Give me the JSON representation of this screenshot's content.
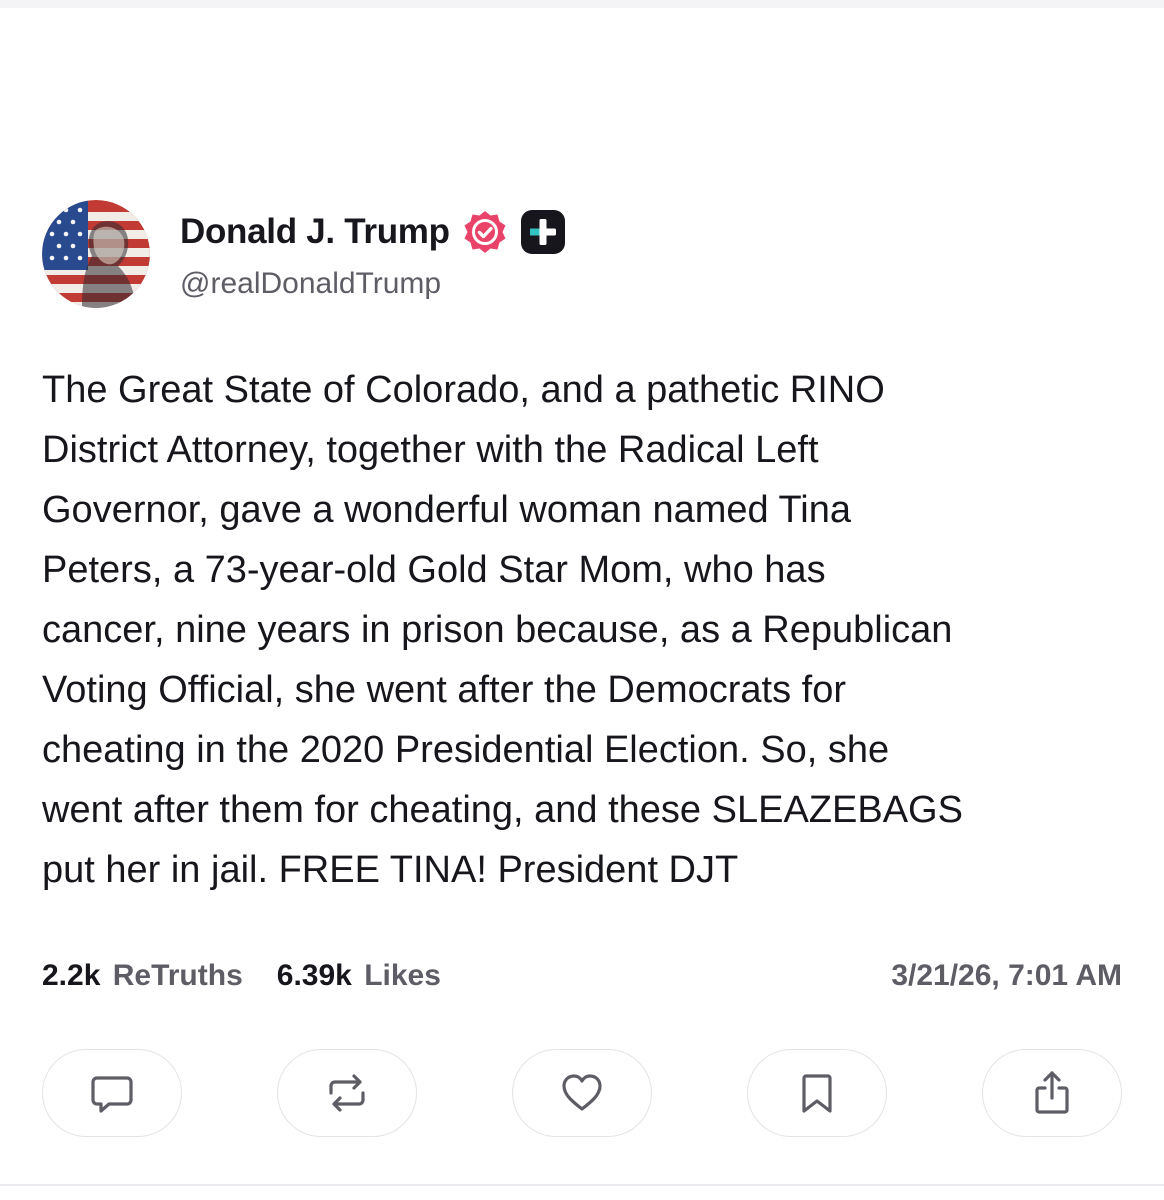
{
  "author": {
    "display_name": "Donald J. Trump",
    "handle": "@realDonaldTrump",
    "verified": true,
    "avatar_icon": "avatar-flag-portrait"
  },
  "post": {
    "text": "The Great State of Colorado, and a pathetic RINO\nDistrict Attorney, together with the Radical Left\nGovernor, gave a wonderful woman named Tina\nPeters, a 73-year-old Gold Star Mom, who has\ncancer, nine years in prison because, as a Republican\nVoting Official, she went after the Democrats for\ncheating in the 2020 Presidential Election. So, she\nwent after them for cheating, and these SLEAZEBAGS\nput her in jail. FREE TINA! President DJT"
  },
  "stats": {
    "retruths_count": "2.2k",
    "retruths_label": "ReTruths",
    "likes_count": "6.39k",
    "likes_label": "Likes",
    "timestamp": "3/21/26, 7:01 AM"
  },
  "actions": [
    {
      "name": "reply",
      "icon": "chat-bubble-icon"
    },
    {
      "name": "retruth",
      "icon": "repost-icon"
    },
    {
      "name": "like",
      "icon": "heart-icon"
    },
    {
      "name": "bookmark",
      "icon": "bookmark-icon"
    },
    {
      "name": "share",
      "icon": "share-icon"
    }
  ],
  "colors": {
    "verified_badge": "#e9436a",
    "plus_badge": "#17161c",
    "text_primary": "#17161c",
    "text_secondary": "#5e5d66",
    "icon_stroke": "#5e5d66"
  }
}
